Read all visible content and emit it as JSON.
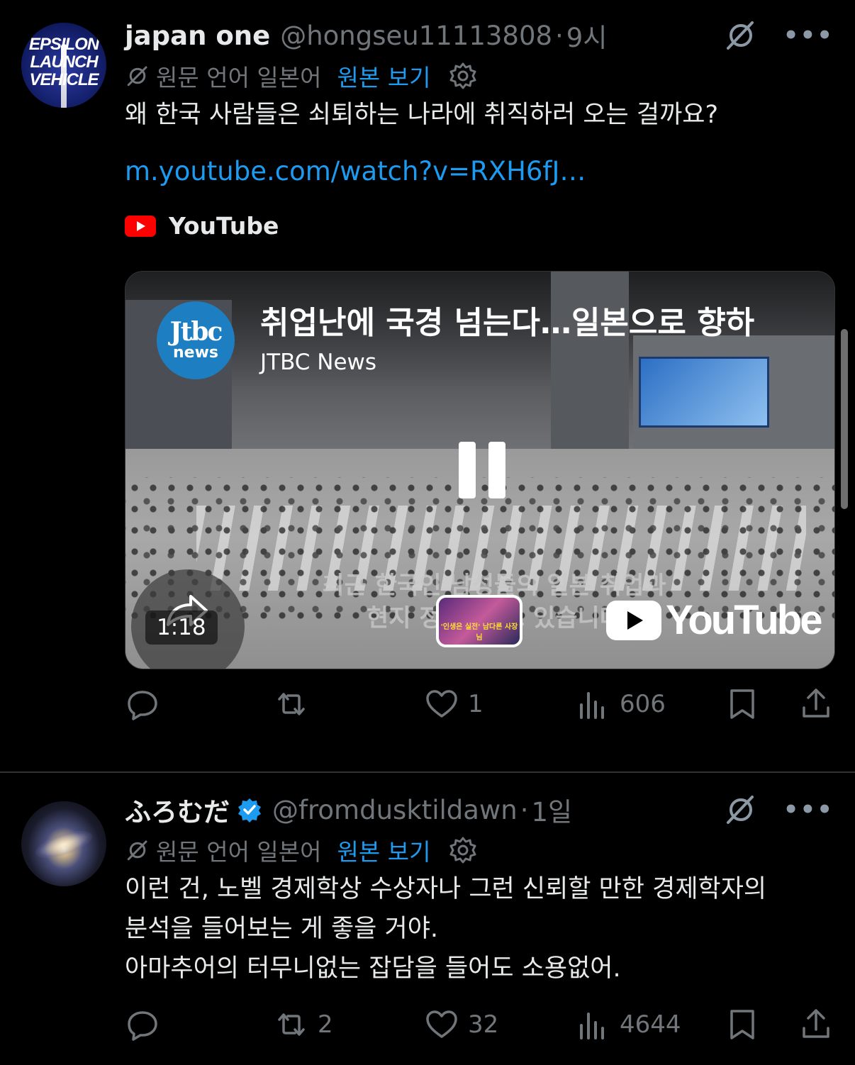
{
  "tweets": [
    {
      "display_name": "japan one",
      "handle": "@hongseu11113808",
      "separator": "·",
      "time": "9시",
      "avatar_text": [
        "EPSILON",
        "LAUNCH",
        "VEHICLE"
      ],
      "translation": {
        "label": "원문 언어 일본어",
        "show_original": "원본 보기"
      },
      "text": "왜 한국 사람들은 쇠퇴하는 나라에 취직하러 오는 걸까요?",
      "link": "m.youtube.com/watch?v=RXH6fJ…",
      "card": {
        "source": "YouTube",
        "video_title": "취업난에 국경 넘는다…일본으로 향하",
        "channel": "JTBC News",
        "channel_logo": [
          "Jtbc",
          "news"
        ],
        "subtitle_lines": [
          "최근 한국인 남성들의 일본 취업과",
          "현지 정착 사          고 있습니다"
        ],
        "duration": "1:18",
        "next_thumb_caption": "'인생은 실전' 남다른 사장님",
        "watermark": "YouTube"
      },
      "stats": {
        "replies": "",
        "reposts": "",
        "likes": "1",
        "views": "606"
      }
    },
    {
      "display_name": "ふろむだ",
      "handle": "@fromdusktildawn",
      "separator": "·",
      "time": "1일",
      "verified": true,
      "translation": {
        "label": "원문 언어 일본어",
        "show_original": "원본 보기"
      },
      "text_lines": [
        "이런 건, 노벨 경제학상 수상자나 그런 신뢰할 만한 경제학자의",
        "분석을 들어보는 게 좋을 거야.",
        "아마추어의 터무니없는 잡담을 들어도 소용없어."
      ],
      "stats": {
        "replies": "",
        "reposts": "2",
        "likes": "32",
        "views": "4644"
      }
    }
  ],
  "colors": {
    "background": "#000000",
    "text": "#e7e9ea",
    "muted": "#71767b",
    "link": "#1d9bf0",
    "verified": "#1d9bf0",
    "youtube_red": "#ff0000"
  },
  "icons": [
    "grok-icon",
    "more-icon",
    "translate-icon",
    "gear-icon",
    "reply-icon",
    "repost-icon",
    "like-icon",
    "views-icon",
    "bookmark-icon",
    "share-icon",
    "verified-badge-icon",
    "youtube-icon",
    "pause-icon"
  ]
}
